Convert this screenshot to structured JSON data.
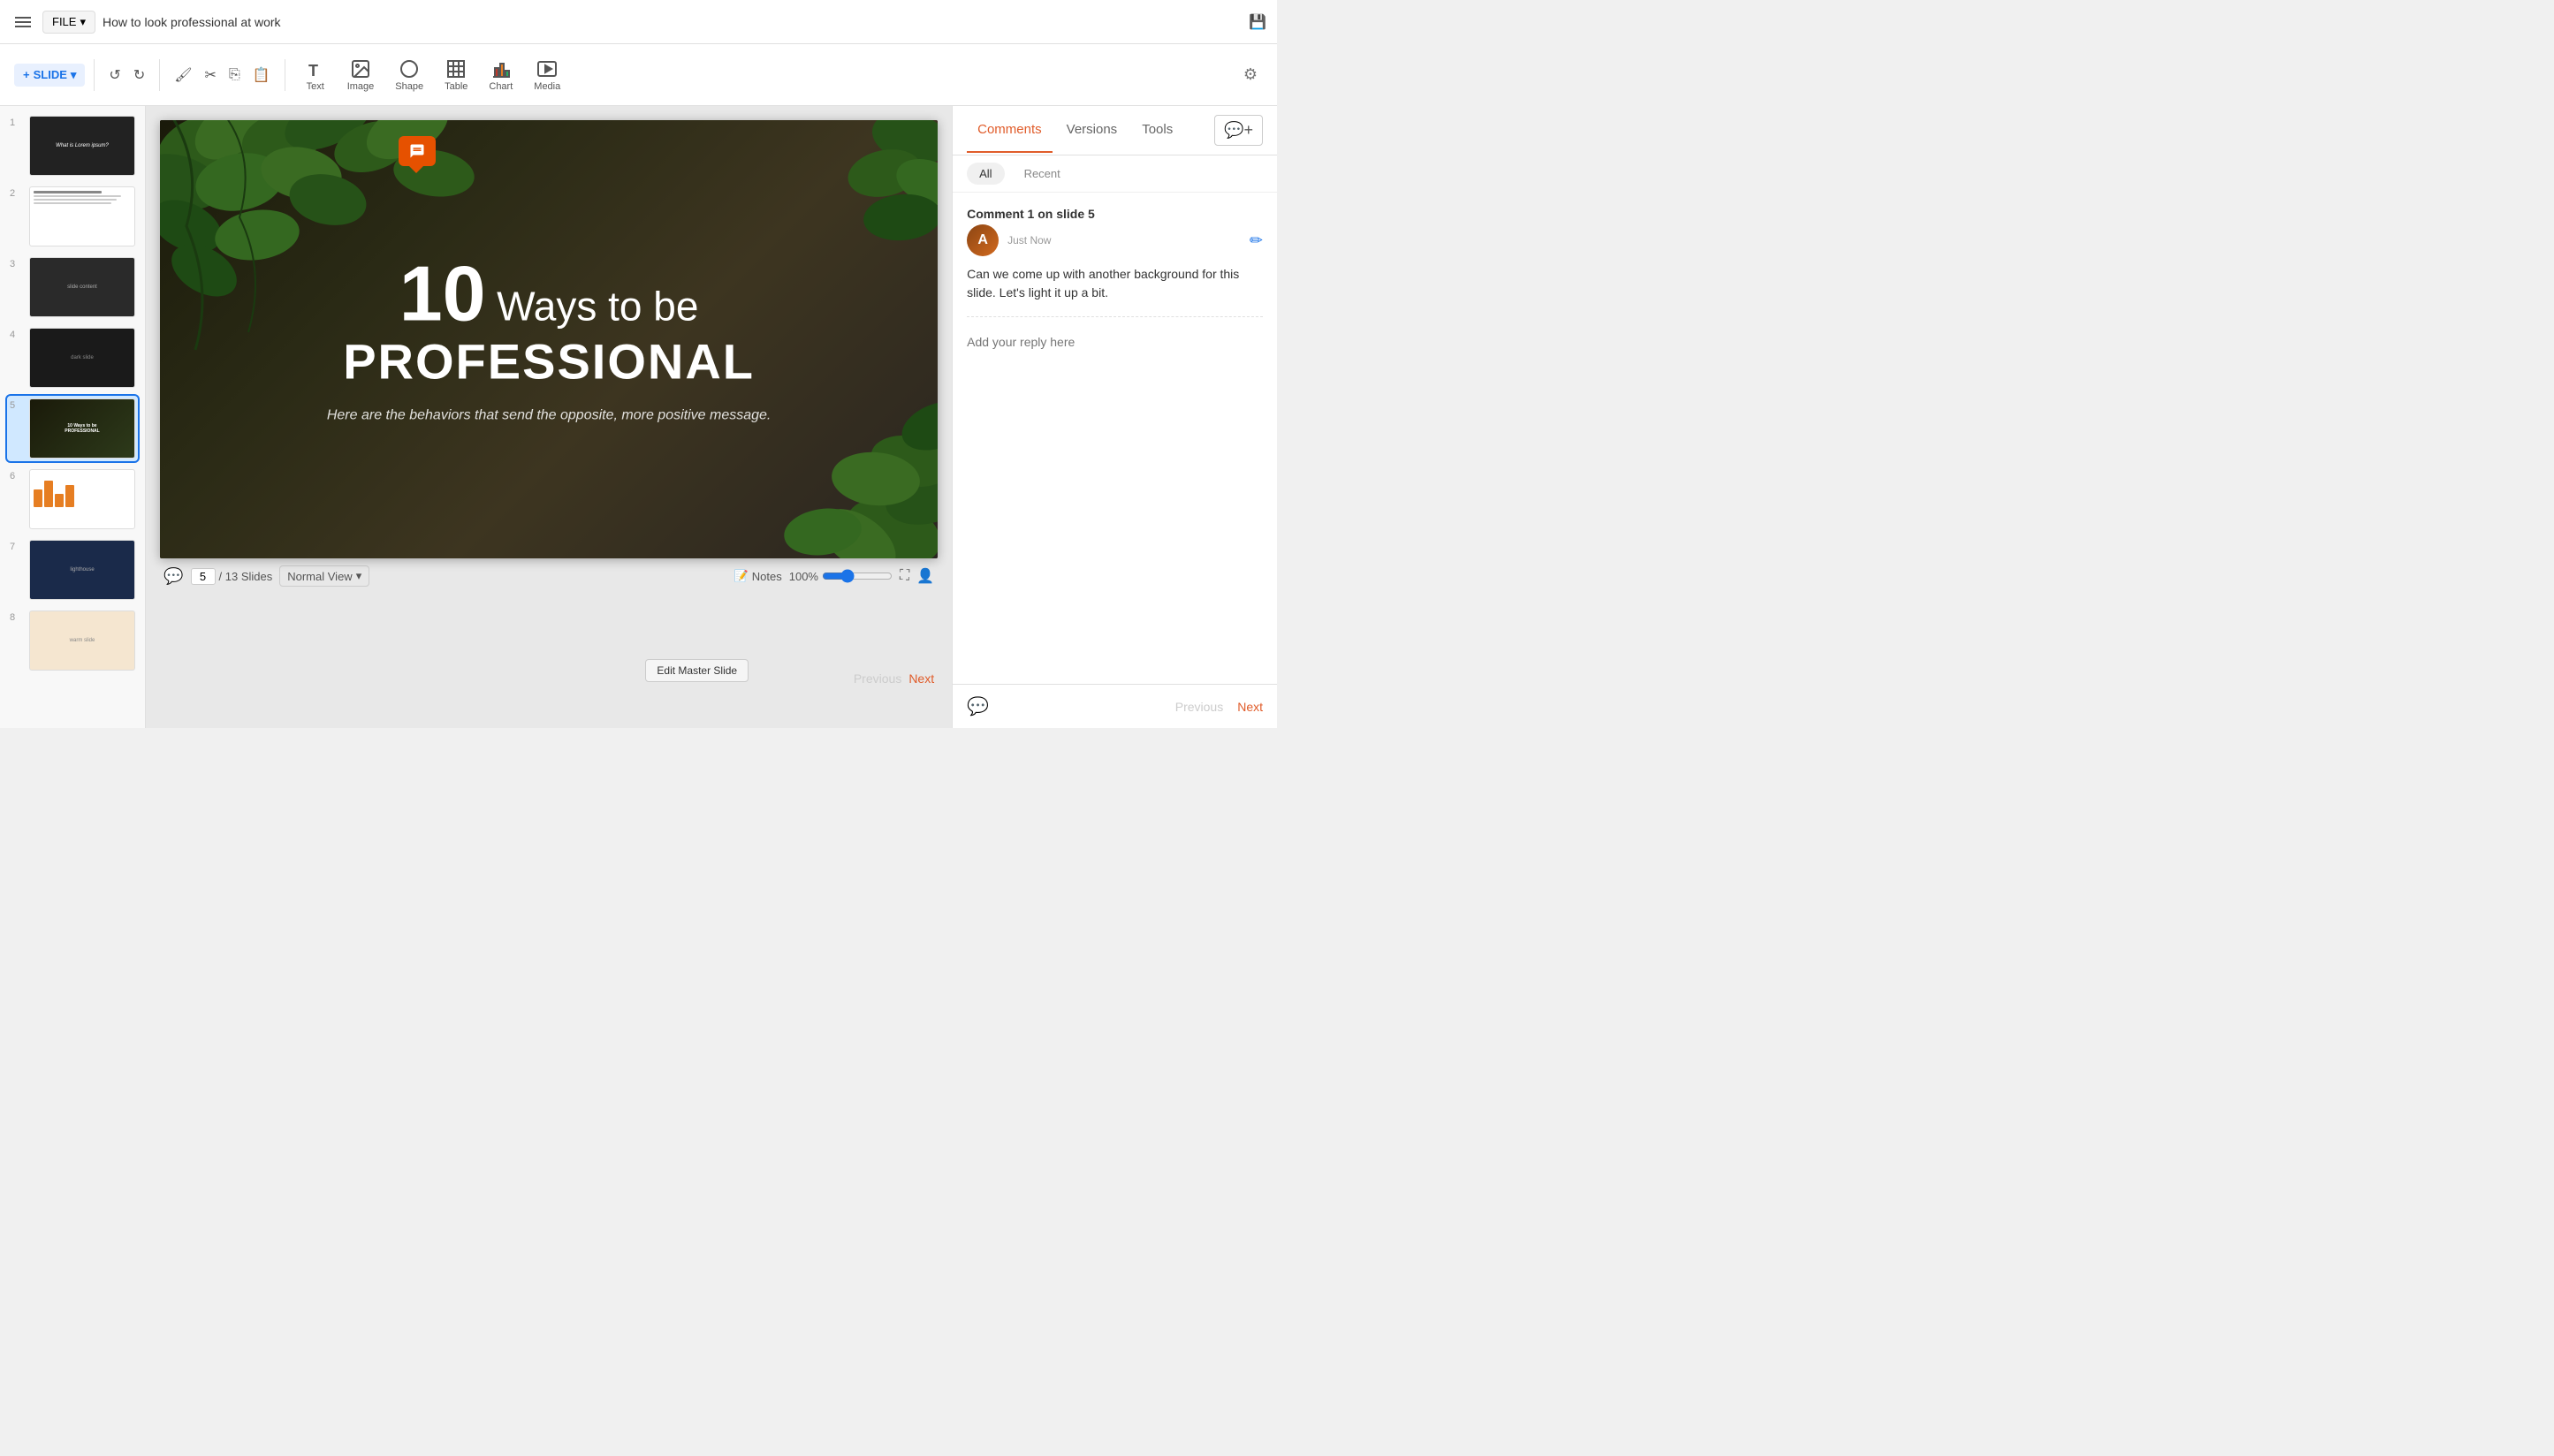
{
  "app": {
    "title": "How to look professional at work",
    "save_icon": "💾"
  },
  "file_menu": {
    "label": "FILE",
    "dropdown_icon": "▾"
  },
  "toolbar": {
    "slide_btn": "SLIDE",
    "tools": [
      {
        "id": "text",
        "label": "Text",
        "icon": "T"
      },
      {
        "id": "image",
        "label": "Image",
        "icon": "🖼"
      },
      {
        "id": "shape",
        "label": "Shape",
        "icon": "◯"
      },
      {
        "id": "table",
        "label": "Table",
        "icon": "⊞"
      },
      {
        "id": "chart",
        "label": "Chart",
        "icon": "📊"
      },
      {
        "id": "media",
        "label": "Media",
        "icon": "▶"
      }
    ]
  },
  "slides": [
    {
      "num": 1,
      "type": "dark-title"
    },
    {
      "num": 2,
      "type": "white-content"
    },
    {
      "num": 3,
      "type": "dark-image"
    },
    {
      "num": 4,
      "type": "dark-split"
    },
    {
      "num": 5,
      "type": "green-leaves",
      "active": true
    },
    {
      "num": 6,
      "type": "white-chart"
    },
    {
      "num": 7,
      "type": "blue-dark"
    },
    {
      "num": 8,
      "type": "warm-light"
    }
  ],
  "slide_content": {
    "number": "10",
    "ways_text": "Ways to be",
    "professional": "PROFESSIONAL",
    "subtitle": "Here are the behaviors that send the opposite, more positive message.",
    "comment_indicator": "💬"
  },
  "bottom_bar": {
    "slide_num": "5",
    "total_slides": "/ 13 Slides",
    "view_label": "Normal View",
    "notes_label": "Notes",
    "zoom_pct": "100%",
    "edit_master_label": "Edit Master Slide"
  },
  "nav": {
    "previous_label": "Previous",
    "next_label": "Next"
  },
  "panel": {
    "tabs": [
      {
        "id": "comments",
        "label": "Comments",
        "active": true
      },
      {
        "id": "versions",
        "label": "Versions"
      },
      {
        "id": "tools",
        "label": "Tools"
      }
    ],
    "filter": {
      "all_label": "All",
      "recent_label": "Recent"
    },
    "comment": {
      "header": "Comment 1 on slide 5",
      "user_initials": "A",
      "timestamp": "Just Now",
      "body": "Can we come up with another background for this slide. Let's light it up a bit.",
      "reply_placeholder": "Add your reply here"
    }
  }
}
